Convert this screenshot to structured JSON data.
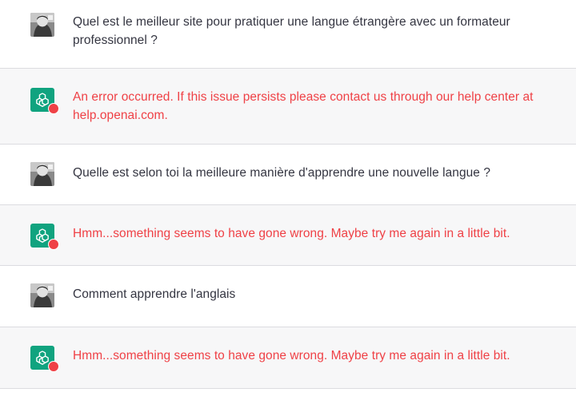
{
  "colors": {
    "user_bg": "#ffffff",
    "bot_bg": "#f7f7f8",
    "user_text": "#343541",
    "error_text": "#ef4146",
    "bot_avatar": "#10a37f",
    "error_badge": "#ef4146"
  },
  "messages": [
    {
      "role": "user",
      "avatar_icon": "user-photo-icon",
      "text": "Quel est le meilleur site pour pratiquer une langue étrangère avec un formateur professionnel ?"
    },
    {
      "role": "assistant",
      "avatar_icon": "chatgpt-logo-icon",
      "status": "error",
      "text": "An error occurred. If this issue persists please contact us through our help center at help.openai.com."
    },
    {
      "role": "user",
      "avatar_icon": "user-photo-icon",
      "text": "Quelle est selon toi la meilleure manière d'apprendre une nouvelle langue ?"
    },
    {
      "role": "assistant",
      "avatar_icon": "chatgpt-logo-icon",
      "status": "error",
      "text": "Hmm...something seems to have gone wrong. Maybe try me again in a little bit."
    },
    {
      "role": "user",
      "avatar_icon": "user-photo-icon",
      "text": "Comment apprendre l'anglais"
    },
    {
      "role": "assistant",
      "avatar_icon": "chatgpt-logo-icon",
      "status": "error",
      "text": "Hmm...something seems to have gone wrong. Maybe try me again in a little bit."
    }
  ]
}
